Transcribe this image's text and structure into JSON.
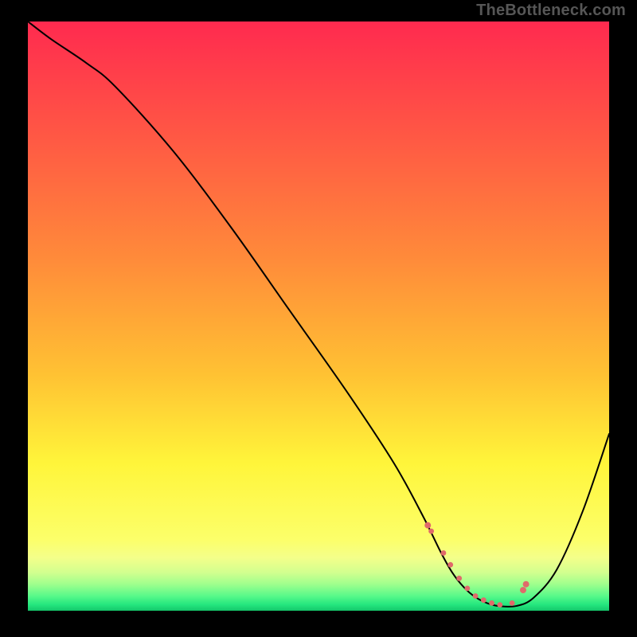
{
  "attribution": "TheBottleneck.com",
  "chart_data": {
    "type": "line",
    "title": "",
    "xlabel": "",
    "ylabel": "",
    "xlim": [
      0,
      100
    ],
    "ylim": [
      0,
      100
    ],
    "grid": false,
    "legend": false,
    "gradient_stops": [
      {
        "offset": 0.0,
        "color": "#ff2a4f"
      },
      {
        "offset": 0.2,
        "color": "#ff5944"
      },
      {
        "offset": 0.4,
        "color": "#ff8a3a"
      },
      {
        "offset": 0.6,
        "color": "#ffc233"
      },
      {
        "offset": 0.75,
        "color": "#fff53a"
      },
      {
        "offset": 0.88,
        "color": "#fcff6a"
      },
      {
        "offset": 0.91,
        "color": "#f4ff8a"
      },
      {
        "offset": 0.935,
        "color": "#d2ff8f"
      },
      {
        "offset": 0.955,
        "color": "#9fff8d"
      },
      {
        "offset": 0.975,
        "color": "#58f98a"
      },
      {
        "offset": 0.99,
        "color": "#24e67e"
      },
      {
        "offset": 1.0,
        "color": "#14c76a"
      }
    ],
    "series": [
      {
        "name": "curve",
        "x": [
          0,
          4,
          10,
          15,
          25,
          35,
          45,
          55,
          63,
          68,
          71,
          73,
          75,
          77,
          79,
          81,
          84,
          87,
          91,
          95.5,
          100
        ],
        "y": [
          100,
          97,
          93,
          89,
          78,
          65,
          51,
          37,
          25,
          16,
          10,
          6.5,
          4,
          2.3,
          1.3,
          0.8,
          0.8,
          2.2,
          7,
          17,
          30
        ]
      }
    ],
    "markers": {
      "name": "highlight-points",
      "color": "#e06a6a",
      "radius_primary": 4.0,
      "radius_secondary": 3.4,
      "x": [
        68.8,
        69.4,
        71.5,
        72.7,
        74.2,
        75.6,
        77.0,
        78.4,
        79.8,
        81.2,
        83.3,
        85.2,
        85.7
      ],
      "y": [
        14.5,
        13.5,
        9.8,
        7.8,
        5.5,
        3.8,
        2.5,
        1.8,
        1.3,
        1.0,
        1.3,
        3.5,
        4.5
      ],
      "primary_idx": [
        0,
        11,
        12
      ],
      "secondary_idx": [
        1,
        2,
        3,
        4,
        5,
        6,
        7,
        8,
        9,
        10
      ]
    }
  }
}
